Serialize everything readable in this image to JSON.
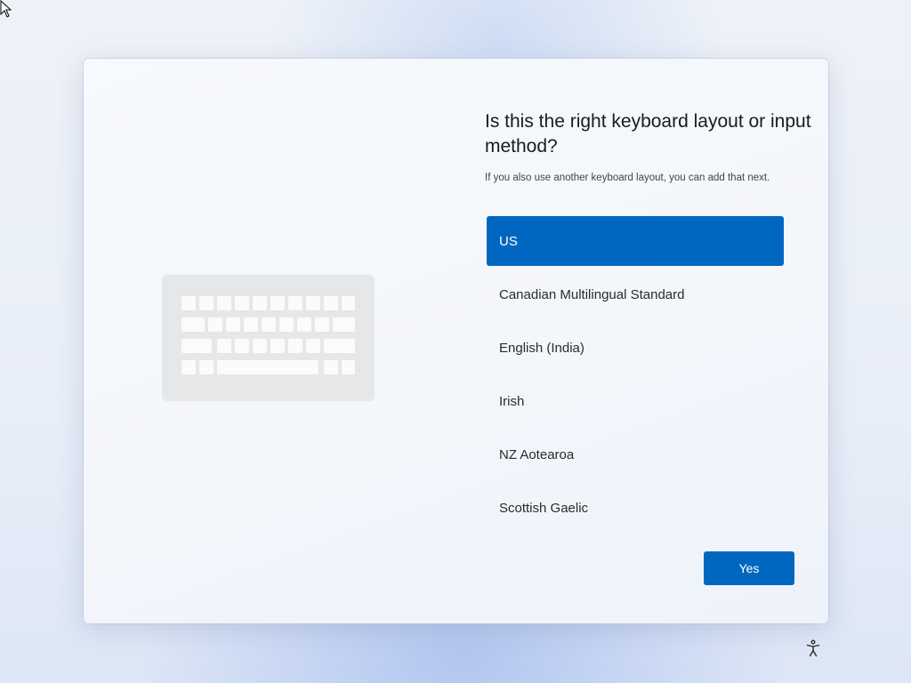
{
  "oobe": {
    "title": "Is this the right keyboard layout or input method?",
    "subtitle": "If you also use another keyboard layout, you can add that next.",
    "layouts": [
      {
        "label": "US",
        "selected": true
      },
      {
        "label": "Canadian Multilingual Standard",
        "selected": false
      },
      {
        "label": "English (India)",
        "selected": false
      },
      {
        "label": "Irish",
        "selected": false
      },
      {
        "label": "NZ Aotearoa",
        "selected": false
      },
      {
        "label": "Scottish Gaelic",
        "selected": false
      }
    ],
    "yes_label": "Yes"
  },
  "icons": {
    "illustration": "keyboard-icon",
    "accessibility": "accessibility-icon",
    "cursor": "mouse-pointer-icon"
  },
  "colors": {
    "accent": "#0067c0",
    "card": "#f4f7fc",
    "text": "#1b1b1b"
  }
}
